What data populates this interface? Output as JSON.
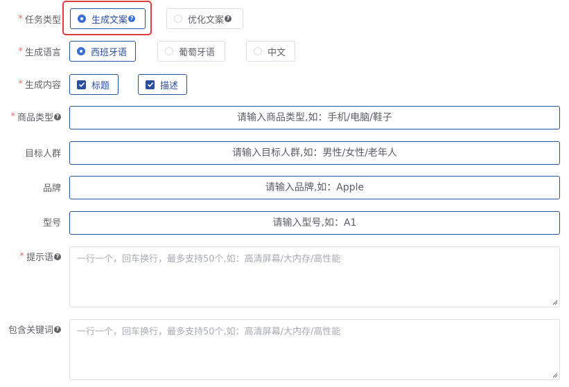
{
  "task_type": {
    "label": "任务类型",
    "options": [
      {
        "label": "生成文案",
        "selected": true
      },
      {
        "label": "优化文案",
        "selected": false
      }
    ]
  },
  "language": {
    "label": "生成语言",
    "options": [
      {
        "label": "西班牙语",
        "selected": true
      },
      {
        "label": "葡萄牙语",
        "selected": false
      },
      {
        "label": "中文",
        "selected": false
      }
    ]
  },
  "content": {
    "label": "生成内容",
    "options": [
      {
        "label": "标题",
        "checked": true
      },
      {
        "label": "描述",
        "checked": true
      }
    ]
  },
  "product_type": {
    "label": "商品类型",
    "placeholder": "请输入商品类型,如：手机/电脑/鞋子"
  },
  "audience": {
    "label": "目标人群",
    "placeholder": "请输入目标人群,如：男性/女性/老年人"
  },
  "brand": {
    "label": "品牌",
    "placeholder": "请输入品牌,如：Apple"
  },
  "model": {
    "label": "型号",
    "placeholder": "请输入型号,如：A1"
  },
  "prompt": {
    "label": "提示语",
    "placeholder": "一行一个，回车换行，最多支持50个,如：高清屏幕/大内存/高性能"
  },
  "keywords": {
    "label": "包含关键词",
    "placeholder": "一行一个，回车换行，最多支持50个,如：高清屏幕/大内存/高性能"
  },
  "colors": {
    "accent": "#2a4fa0",
    "radio": "#3b6fd8",
    "required": "#f56c6c",
    "highlight": "#e23b3b"
  }
}
